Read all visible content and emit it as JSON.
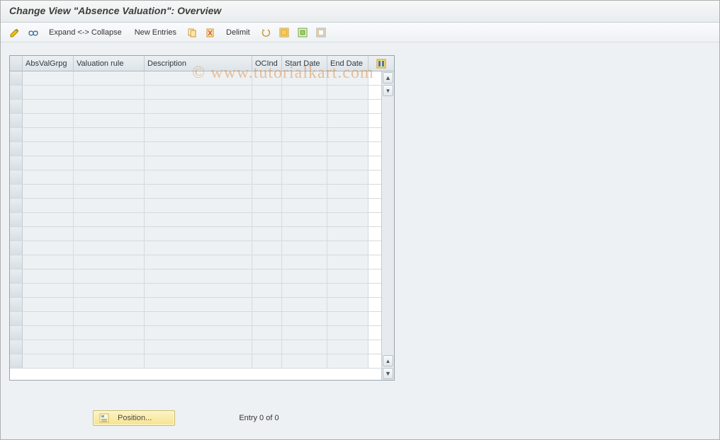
{
  "title": "Change View \"Absence Valuation\": Overview",
  "watermark": "© www.tutorialkart.com",
  "toolbar": {
    "expandCollapse": "Expand <-> Collapse",
    "newEntries": "New Entries",
    "delimit": "Delimit"
  },
  "grid": {
    "columns": [
      "AbsValGrpg",
      "Valuation rule",
      "Description",
      "OCInd",
      "Start Date",
      "End Date"
    ],
    "rowCount": 21
  },
  "footer": {
    "positionLabel": "Position...",
    "entryText": "Entry 0 of 0"
  }
}
